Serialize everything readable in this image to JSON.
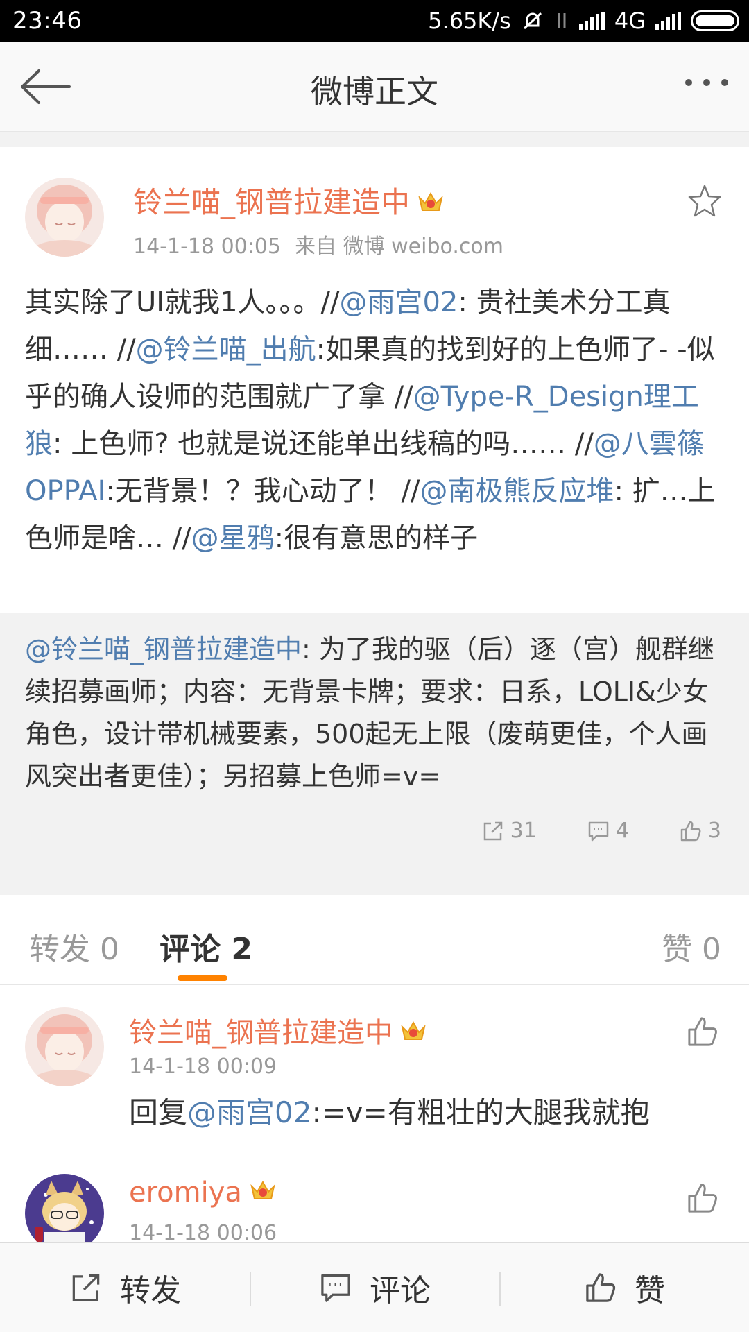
{
  "status_bar": {
    "time": "23:46",
    "speed": "5.65K/s",
    "network": "4G"
  },
  "header": {
    "title": "微博正文"
  },
  "post": {
    "author": "铃兰喵_钢普拉建造中",
    "time": "14-1-18 00:05",
    "source": "来自 微博 weibo.com",
    "segments": [
      {
        "t": "其实除了UI就我1人。。。//"
      },
      {
        "t": "@雨宫02",
        "m": true
      },
      {
        "t": ": 贵社美术分工真细…… //"
      },
      {
        "t": "@铃兰喵_出航",
        "m": true
      },
      {
        "t": ":如果真的找到好的上色师了- -似乎的确人设师的范围就广了拿 //"
      },
      {
        "t": "@Type-R_Design理工狼",
        "m": true
      },
      {
        "t": ": 上色师? 也就是说还能单出线稿的吗…… //"
      },
      {
        "t": "@八雲篠OPPAI",
        "m": true
      },
      {
        "t": ":无背景！？我心动了！ //"
      },
      {
        "t": "@南极熊反应堆",
        "m": true
      },
      {
        "t": ": 扩…上色师是啥… //"
      },
      {
        "t": "@星鸦",
        "m": true
      },
      {
        "t": ":很有意思的样子"
      }
    ]
  },
  "retweet": {
    "mention": "@铃兰喵_钢普拉建造中",
    "text": ": 为了我的驱（后）逐（宫）舰群继续招募画师；内容：无背景卡牌；要求：日系，LOLI&少女角色，设计带机械要素，500起无上限（废萌更佳，个人画风突出者更佳）；另招募上色师=v=",
    "reposts": "31",
    "comments": "4",
    "likes": "3"
  },
  "tabs": {
    "repost": "转发 0",
    "comment": "评论 2",
    "like": "赞 0"
  },
  "comments": [
    {
      "author": "铃兰喵_钢普拉建造中",
      "time": "14-1-18 00:09",
      "reply_prefix": "回复",
      "mention": "@雨宫02",
      "text": ":=v=有粗壮的大腿我就抱"
    },
    {
      "author": "eromiya",
      "time": "14-1-18 00:06"
    }
  ],
  "bottom_bar": {
    "repost": "转发",
    "comment": "评论",
    "like": "赞"
  },
  "colors": {
    "accent_orange": "#ff8200",
    "name_orange": "#eb7350",
    "link_blue": "#507daf"
  },
  "icons": [
    "back-arrow-icon",
    "more-icon",
    "star-icon",
    "crown-icon",
    "repost-icon",
    "comment-icon",
    "like-icon"
  ]
}
